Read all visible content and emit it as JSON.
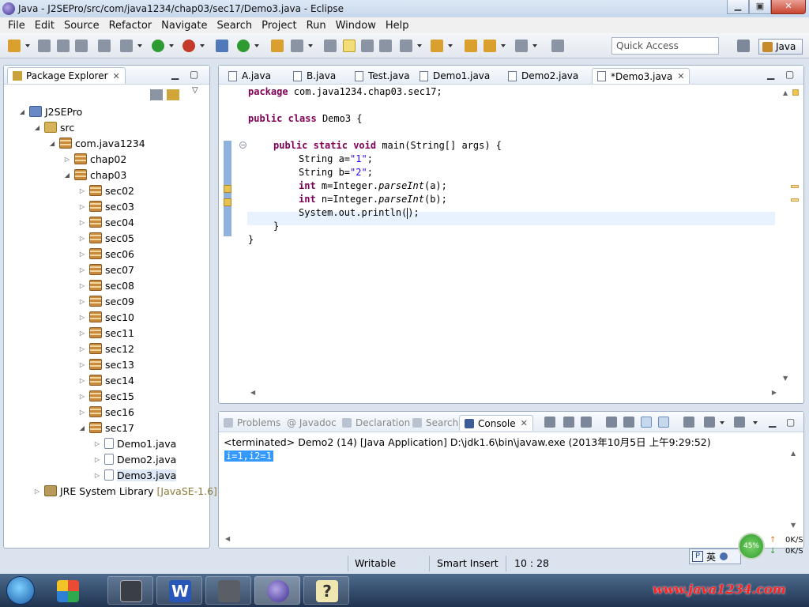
{
  "window": {
    "title": "Java - J2SEPro/src/com/java1234/chap03/sec17/Demo3.java - Eclipse",
    "minimize": "▁",
    "maximize": "▣",
    "close": "✕"
  },
  "menu": [
    "File",
    "Edit",
    "Source",
    "Refactor",
    "Navigate",
    "Search",
    "Project",
    "Run",
    "Window",
    "Help"
  ],
  "toolbar": {
    "quick_access_placeholder": "Quick Access",
    "perspective": "Java"
  },
  "explorer": {
    "title": "Package Explorer",
    "tree": [
      {
        "label": "J2SEPro",
        "icon": "project-icon",
        "level": 0,
        "expanded": true
      },
      {
        "label": "src",
        "icon": "source-folder-icon",
        "level": 1,
        "expanded": true
      },
      {
        "label": "com.java1234",
        "icon": "package-icon",
        "level": 2,
        "expanded": true
      },
      {
        "label": "chap02",
        "icon": "package-icon",
        "level": 3,
        "expanded": false
      },
      {
        "label": "chap03",
        "icon": "package-icon",
        "level": 3,
        "expanded": true
      },
      {
        "label": "sec02",
        "icon": "package-icon",
        "level": 4,
        "expanded": false
      },
      {
        "label": "sec03",
        "icon": "package-icon",
        "level": 4,
        "expanded": false
      },
      {
        "label": "sec04",
        "icon": "package-icon",
        "level": 4,
        "expanded": false
      },
      {
        "label": "sec05",
        "icon": "package-icon",
        "level": 4,
        "expanded": false
      },
      {
        "label": "sec06",
        "icon": "package-icon",
        "level": 4,
        "expanded": false
      },
      {
        "label": "sec07",
        "icon": "package-icon",
        "level": 4,
        "expanded": false
      },
      {
        "label": "sec08",
        "icon": "package-icon",
        "level": 4,
        "expanded": false
      },
      {
        "label": "sec09",
        "icon": "package-icon",
        "level": 4,
        "expanded": false
      },
      {
        "label": "sec10",
        "icon": "package-icon",
        "level": 4,
        "expanded": false
      },
      {
        "label": "sec11",
        "icon": "package-icon",
        "level": 4,
        "expanded": false
      },
      {
        "label": "sec12",
        "icon": "package-icon",
        "level": 4,
        "expanded": false
      },
      {
        "label": "sec13",
        "icon": "package-icon",
        "level": 4,
        "expanded": false
      },
      {
        "label": "sec14",
        "icon": "package-icon",
        "level": 4,
        "expanded": false
      },
      {
        "label": "sec15",
        "icon": "package-icon",
        "level": 4,
        "expanded": false
      },
      {
        "label": "sec16",
        "icon": "package-icon",
        "level": 4,
        "expanded": false
      },
      {
        "label": "sec17",
        "icon": "package-icon",
        "level": 4,
        "expanded": true
      },
      {
        "label": "Demo1.java",
        "icon": "java-file-icon",
        "level": 5,
        "expanded": false
      },
      {
        "label": "Demo2.java",
        "icon": "java-file-icon",
        "level": 5,
        "expanded": false
      },
      {
        "label": "Demo3.java",
        "icon": "java-file-icon",
        "level": 5,
        "expanded": false,
        "selected": true
      },
      {
        "label": "JRE System Library",
        "icon": "library-icon",
        "level": 1,
        "expanded": false,
        "version": "[JavaSE-1.6]"
      }
    ]
  },
  "editor": {
    "tabs": [
      "A.java",
      "B.java",
      "Test.java",
      "Demo1.java",
      "Demo2.java",
      "*Demo3.java"
    ],
    "active_tab": 5,
    "code": {
      "l1_pre": "package ",
      "l1_rest": "com.java1234.chap03.sec17;",
      "l3_kw1": "public",
      "l3_kw2": "class",
      "l3_rest": " Demo3 {",
      "l5_kw1": "public",
      "l5_kw2": "static",
      "l5_kw3": "void",
      "l5_rest": " main(String[] args) {",
      "l6_pre": "String a=",
      "l6_str": "\"1\"",
      "l6_end": ";",
      "l7_pre": "String b=",
      "l7_str": "\"2\"",
      "l7_end": ";",
      "l8_kw": "int",
      "l8_pre": " m=Integer.",
      "l8_it": "parseInt",
      "l8_end": "(a);",
      "l9_kw": "int",
      "l9_pre": " n=Integer.",
      "l9_it": "parseInt",
      "l9_end": "(b);",
      "l10_pre": "System.out.println(",
      "l10_end": ");",
      "l11": "}",
      "l12": "}"
    }
  },
  "console": {
    "tabs": [
      "Problems",
      "@ Javadoc",
      "Declaration",
      "Search",
      "Console"
    ],
    "active_tab": "Console",
    "status": "<terminated> Demo2 (14) [Java Application] D:\\jdk1.6\\bin\\javaw.exe (2013年10月5日 上午9:29:52)",
    "output": "i=1,i2=1"
  },
  "statusbar": {
    "writable": "Writable",
    "insert_mode": "Smart Insert",
    "position": "10 : 28"
  },
  "tray": {
    "ime_label": "英",
    "ime_p": "P",
    "cpu": "45%",
    "up_rate": "0K/S",
    "down_rate": "0K/S"
  },
  "watermark": "www.java1234.com"
}
